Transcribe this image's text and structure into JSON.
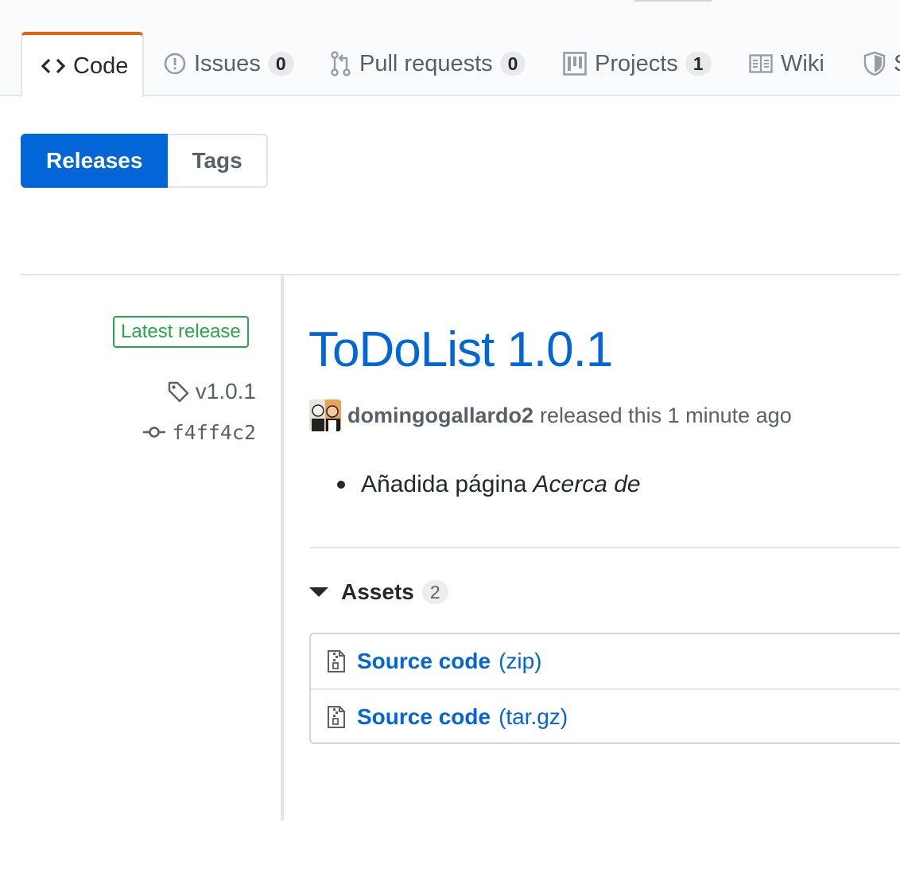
{
  "repo_tabs": [
    {
      "label": "Code",
      "icon": "code-icon",
      "selected": true
    },
    {
      "label": "Issues",
      "count": "0",
      "icon": "issue-opened-icon"
    },
    {
      "label": "Pull requests",
      "count": "0",
      "icon": "git-pull-request-icon"
    },
    {
      "label": "Projects",
      "count": "1",
      "icon": "project-icon"
    },
    {
      "label": "Wiki",
      "icon": "book-icon"
    },
    {
      "label": "S",
      "icon": "shield-icon"
    }
  ],
  "subnav": {
    "releases_label": "Releases",
    "tags_label": "Tags"
  },
  "release": {
    "badge": "Latest release",
    "tag": "v1.0.1",
    "commit": "f4ff4c2",
    "title": "ToDoList 1.0.1",
    "author": "domingogallardo2",
    "released_text": "released this 1 minute ago",
    "notes": [
      {
        "text": "Añadida página",
        "emphasis": "Acerca de"
      }
    ]
  },
  "assets": {
    "label": "Assets",
    "count": "2",
    "items": [
      {
        "name": "Source code",
        "format": "(zip)",
        "icon": "file-zip-icon"
      },
      {
        "name": "Source code",
        "format": "(tar.gz)",
        "icon": "file-zip-icon"
      }
    ]
  },
  "colors": {
    "accent": "#0366d6",
    "tab_underline": "#e36209",
    "success": "#28a745"
  }
}
